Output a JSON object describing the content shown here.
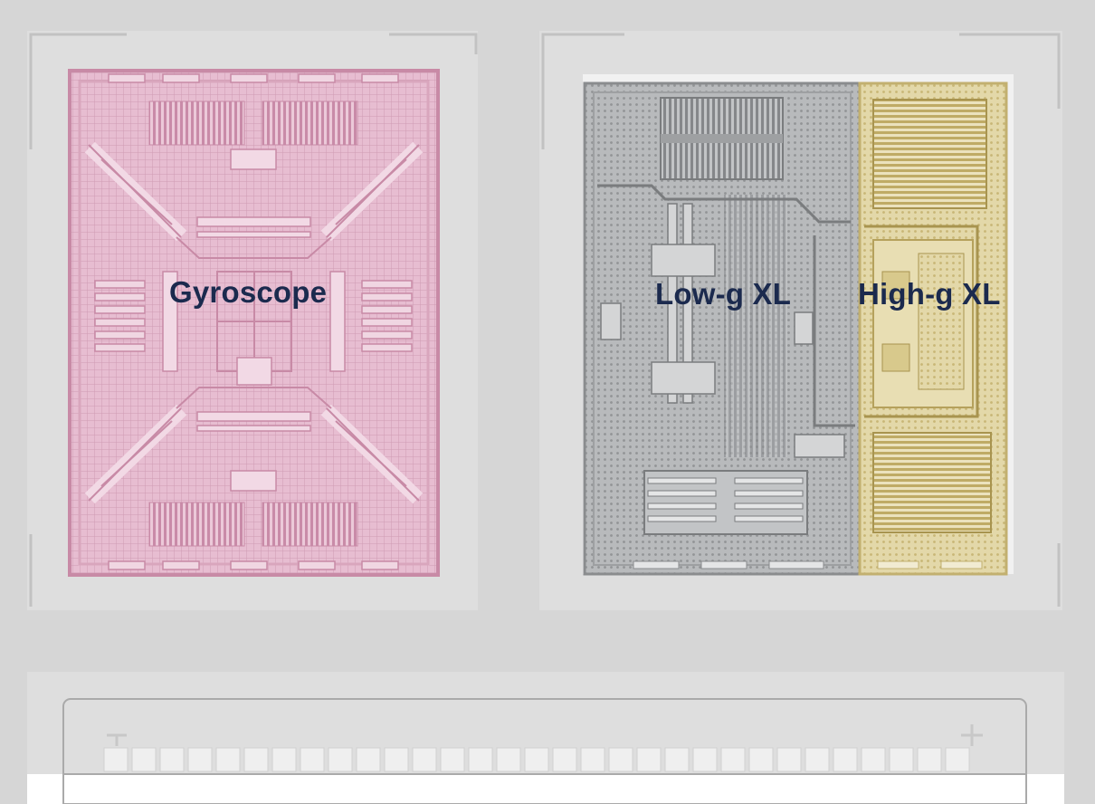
{
  "labels": {
    "gyroscope": "Gyroscope",
    "low_g": "Low-g XL",
    "high_g": "High-g XL"
  },
  "colors": {
    "background": "#d6d6d6",
    "gyroscope_tint": "#e6bcd0",
    "gyroscope_line": "#c88aa6",
    "low_g_tint": "#b4b6b8",
    "low_g_line": "#8a8c8e",
    "high_g_tint": "#e2d7a8",
    "high_g_line": "#c2b070",
    "label_text": "#1b2a4e"
  }
}
